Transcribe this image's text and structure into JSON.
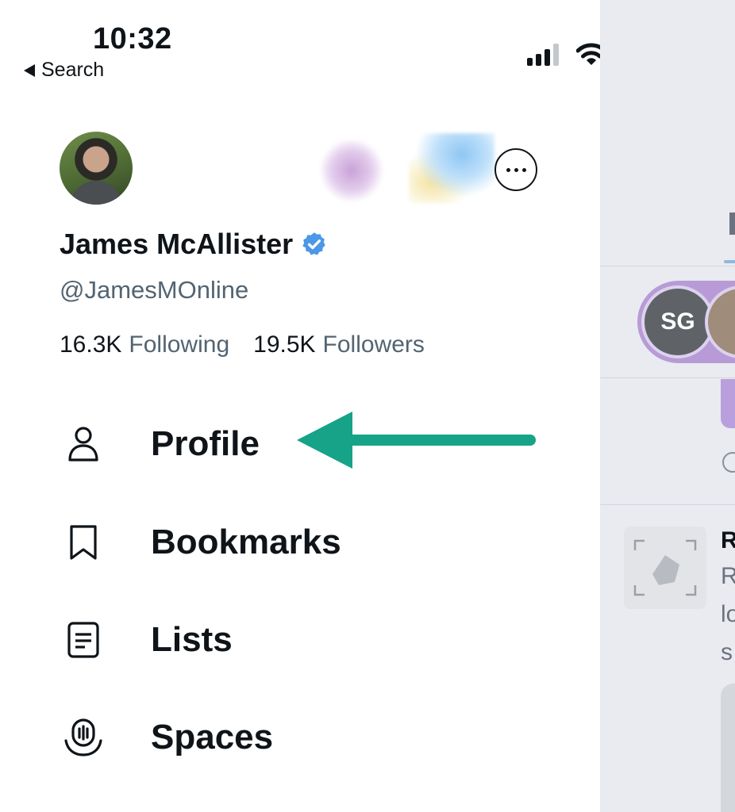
{
  "status_bar": {
    "time": "10:32",
    "back_label": "Search",
    "icons": [
      "cellular-signal-icon",
      "wifi-icon",
      "battery-icon"
    ]
  },
  "account": {
    "name": "James McAllister",
    "verified": true,
    "handle": "@JamesMOnline",
    "following_count": "16.3K",
    "following_label": "Following",
    "followers_count": "19.5K",
    "followers_label": "Followers"
  },
  "menu": {
    "items": [
      {
        "label": "Profile",
        "icon": "person-icon"
      },
      {
        "label": "Bookmarks",
        "icon": "bookmark-icon"
      },
      {
        "label": "Lists",
        "icon": "list-icon"
      },
      {
        "label": "Spaces",
        "icon": "spaces-icon"
      }
    ]
  },
  "annotation": {
    "arrow_color": "#16a388",
    "points_to": "Profile"
  },
  "colors": {
    "text_primary": "#0f1419",
    "text_secondary": "#536471",
    "verified_badge": "#1d9bf0"
  },
  "background_feed": {
    "spaces_avatar_text": "SG",
    "text_fragments": [
      "R",
      "R",
      "lo",
      "s"
    ]
  }
}
